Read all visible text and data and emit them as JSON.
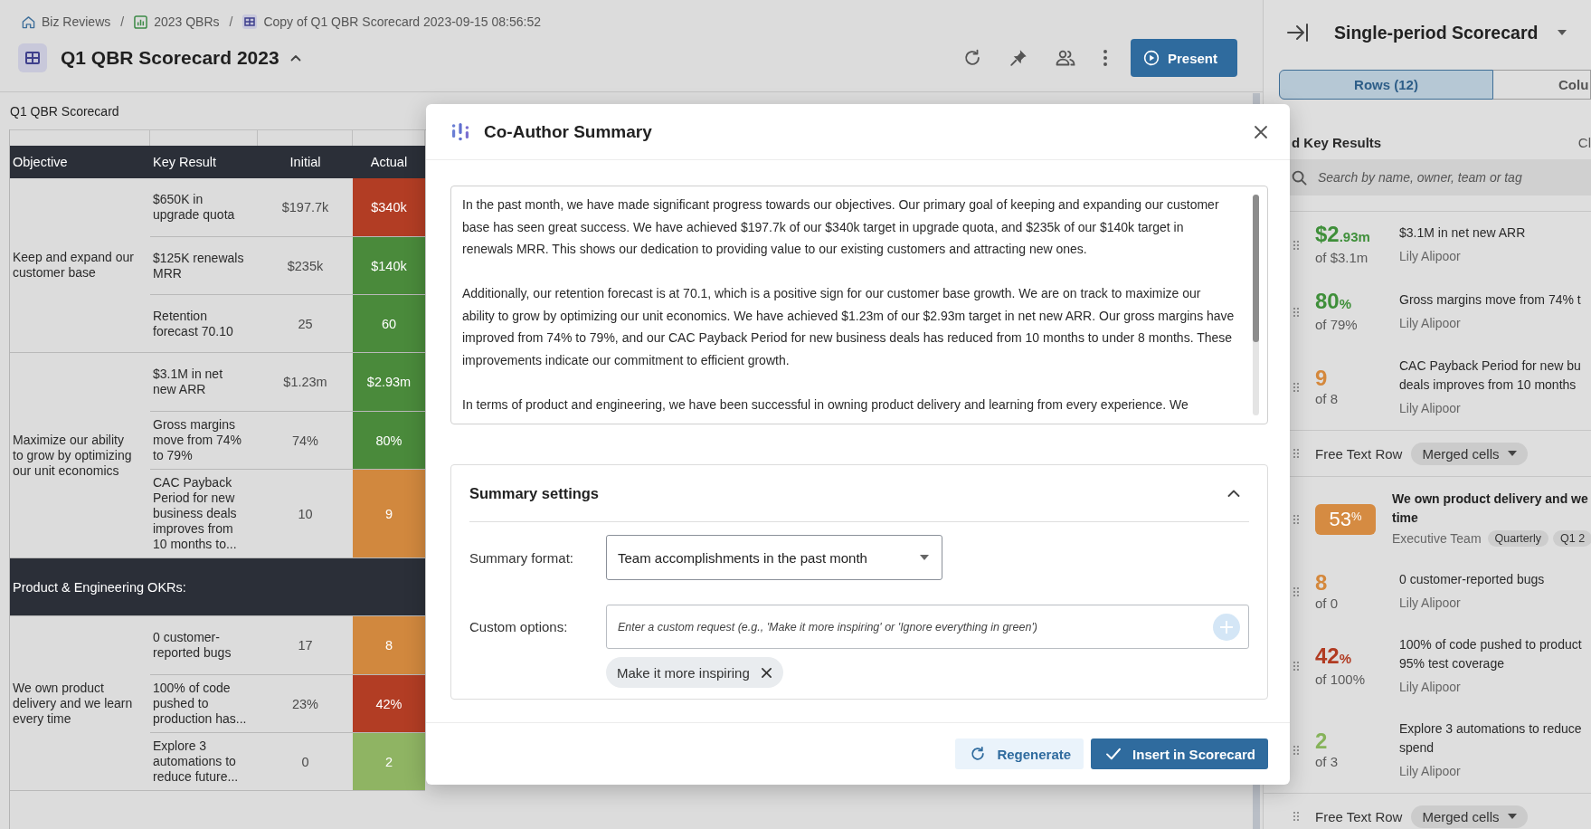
{
  "breadcrumbs": [
    {
      "kind": "home",
      "label": "Biz Reviews"
    },
    {
      "kind": "separator",
      "label": "/"
    },
    {
      "kind": "folder",
      "label": "2023 QBRs"
    },
    {
      "kind": "separator",
      "label": "/"
    },
    {
      "kind": "scorecard",
      "label": "Copy of Q1 QBR Scorecard 2023-09-15 08:56:52"
    }
  ],
  "header": {
    "title": "Q1 QBR Scorecard 2023",
    "present_button": "Present"
  },
  "scorecard": {
    "title": "Q1 QBR Scorecard",
    "columns": [
      "Objective",
      "Key Result",
      "Initial",
      "Actual"
    ],
    "groups": [
      {
        "kind": "objective",
        "objective": "Keep and expand our customer base",
        "rows": [
          {
            "key_result": "$650K in upgrade quota",
            "initial": "$197.7k",
            "actual": "$340k",
            "color": "#b23d24"
          },
          {
            "key_result": "$125K renewals MRR",
            "initial": "$235k",
            "actual": "$140k",
            "color": "#4a8a3b"
          },
          {
            "key_result": "Retention forecast 70.10",
            "initial": "25",
            "actual": "60",
            "color": "#4a8a3b"
          }
        ]
      },
      {
        "kind": "objective",
        "objective": "Maximize our ability to grow by optimizing our unit economics",
        "rows": [
          {
            "key_result": "$3.1M in net new ARR",
            "initial": "$1.23m",
            "actual": "$2.93m",
            "color": "#4a8a3b"
          },
          {
            "key_result": "Gross margins move from 74% to 79%",
            "initial": "74%",
            "actual": "80%",
            "color": "#4a8a3b"
          },
          {
            "key_result": "CAC Payback Period for new business deals improves from 10 months to...",
            "initial": "10",
            "actual": "9",
            "color": "#d1883e"
          }
        ]
      },
      {
        "kind": "section",
        "label": "Product & Engineering OKRs:"
      },
      {
        "kind": "objective",
        "objective": "We own product delivery and we learn every time",
        "rows": [
          {
            "key_result": "0 customer-reported bugs",
            "initial": "17",
            "actual": "8",
            "color": "#d1883e"
          },
          {
            "key_result": "100% of code pushed to production has...",
            "initial": "23%",
            "actual": "42%",
            "color": "#b23d24"
          },
          {
            "key_result": "Explore 3 automations to reduce future...",
            "initial": "0",
            "actual": "2",
            "color": "#8fb463"
          }
        ]
      }
    ]
  },
  "summary_dialog": {
    "title": "Co-Author Summary",
    "paragraphs": [
      "In the past month, we have made significant progress towards our objectives. Our primary goal of keeping and expanding our customer base has seen great success. We have achieved $197.7k of our $340k target in upgrade quota, and $235k of our $140k target in renewals MRR. This shows our dedication to providing value to our existing customers and attracting new ones.",
      "Additionally, our retention forecast is at 70.1, which is a positive sign for our customer base growth. We are on track to maximize our ability to grow by optimizing our unit economics. We have achieved $1.23m of our $2.93m target in net new ARR. Our gross margins have improved from 74% to 79%, and our CAC Payback Period for new business deals has reduced from 10 months to under 8 months. These improvements indicate our commitment to efficient growth.",
      "In terms of product and engineering, we have been successful in owning product delivery and learning from every experience. We"
    ],
    "settings": {
      "title": "Summary settings",
      "expanded": true,
      "format_field": {
        "label": "Summary format:",
        "value": "Team accomplishments in the past month"
      },
      "custom_field": {
        "label": "Custom options:",
        "placeholder": "Enter a custom request (e.g., 'Make it more inspiring' or 'Ignore everything in green')"
      },
      "chips": [
        "Make it more inspiring"
      ]
    },
    "buttons": [
      {
        "kind": "regenerate",
        "label": "Regenerate"
      },
      {
        "kind": "insert",
        "label": "Insert in Scorecard"
      }
    ]
  },
  "side_panel": {
    "title": "Single-period Scorecard",
    "tabs": [
      {
        "label": "Rows (12)",
        "selected": true
      },
      {
        "label": "Colu",
        "selected": false
      }
    ],
    "section_title": "d Key Results",
    "section_action": "Cl",
    "search": {
      "placeholder": "Search by name, owner, team or tag"
    },
    "items": [
      {
        "kind": "key_result",
        "value": "$2",
        "value_suffix": ".93m",
        "target": "of $3.1m",
        "color": "#3f8f3a",
        "name_lines": [
          "$3.1M in net new ARR"
        ],
        "owner": "Lily Alipoor"
      },
      {
        "kind": "key_result",
        "value": "80",
        "value_suffix": "%",
        "target": "of 79%",
        "color": "#3f8f3a",
        "name_lines": [
          "Gross margins move from 74% t"
        ],
        "owner": "Lily Alipoor"
      },
      {
        "kind": "key_result",
        "value": "9",
        "target": "of 8",
        "color": "#d4883c",
        "name_lines": [
          "CAC Payback Period for new bu",
          "deals improves from 10 months"
        ],
        "owner": "Lily Alipoor"
      },
      {
        "kind": "free_text",
        "label": "Free Text Row",
        "chip": "Merged cells"
      },
      {
        "kind": "objective",
        "value": "53",
        "value_suffix": "%",
        "color": "#d58b42",
        "title_lines": [
          "We own product delivery and we",
          "time"
        ],
        "team": "Executive Team",
        "tags": [
          "Quarterly",
          "Q1 2"
        ]
      },
      {
        "kind": "key_result",
        "value": "8",
        "target": "of 0",
        "color": "#d4883c",
        "name_lines": [
          "0 customer-reported bugs"
        ],
        "owner": "Lily Alipoor"
      },
      {
        "kind": "key_result",
        "value": "42",
        "value_suffix": "%",
        "target": "of 100%",
        "color": "#b13b22",
        "name_lines": [
          "100% of code pushed to product",
          "95% test coverage"
        ],
        "owner": "Lily Alipoor"
      },
      {
        "kind": "key_result",
        "value": "2",
        "target": "of 3",
        "color": "#86b35a",
        "name_lines": [
          "Explore 3 automations to reduce",
          "spend"
        ],
        "owner": "Lily Alipoor"
      },
      {
        "kind": "free_text",
        "label": "Free Text Row",
        "chip": "Merged cells"
      }
    ]
  }
}
